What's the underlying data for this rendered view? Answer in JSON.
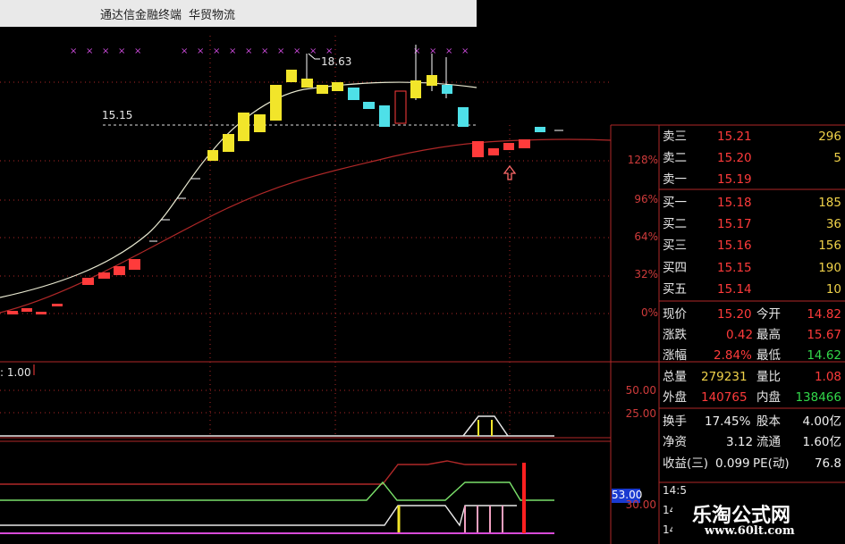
{
  "window": {
    "app_title": "通达信金融终端",
    "stock_name": "华贸物流"
  },
  "chart": {
    "high_marker": "18.63",
    "ref_line_label": "15.15",
    "pct_axis": [
      "128%",
      "96%",
      "64%",
      "32%",
      "0%"
    ],
    "sub1_label": ": 1.00",
    "sub1_axis": [
      "50.00",
      "25.00"
    ],
    "sub2_axis": [
      "53.00",
      "30.00"
    ]
  },
  "quote": {
    "asks": [
      {
        "label": "卖三",
        "price": "15.21",
        "vol": "296"
      },
      {
        "label": "卖二",
        "price": "15.20",
        "vol": "5"
      },
      {
        "label": "卖一",
        "price": "15.19",
        "vol": ""
      }
    ],
    "bids": [
      {
        "label": "买一",
        "price": "15.18",
        "vol": "185"
      },
      {
        "label": "买二",
        "price": "15.17",
        "vol": "36"
      },
      {
        "label": "买三",
        "price": "15.16",
        "vol": "156"
      },
      {
        "label": "买四",
        "price": "15.15",
        "vol": "190"
      },
      {
        "label": "买五",
        "price": "15.14",
        "vol": "10"
      }
    ],
    "stats": {
      "now_label": "现价",
      "now": "15.20",
      "open_label": "今开",
      "open": "14.82",
      "chg_label": "涨跌",
      "chg": "0.42",
      "high_label": "最高",
      "high": "15.67",
      "pct_label": "涨幅",
      "pct": "2.84%",
      "low_label": "最低",
      "low": "14.62",
      "vol_label": "总量",
      "vol": "279231",
      "ratio_label": "量比",
      "ratio": "1.08",
      "out_label": "外盘",
      "out": "140765",
      "in_label": "内盘",
      "in": "138466",
      "turn_label": "换手",
      "turn": "17.45%",
      "cap_label": "股本",
      "cap": "4.00亿",
      "nav_label": "净资",
      "nav": "3.12",
      "float_label": "流通",
      "float": "1.60亿",
      "eps_label": "收益(三)",
      "eps": "0.099",
      "pe_label": "PE(动)",
      "pe": "76.8"
    },
    "ticks_partial": [
      "14:5",
      "14",
      "14"
    ]
  },
  "watermark": {
    "name": "乐淘公式网",
    "url": "www.60lt.com"
  },
  "colors": {
    "up": "#ff3b3b",
    "down": "#4ee0e8",
    "ma_short": "#e8e8d0",
    "ma_long": "#b02828",
    "accent_yellow": "#f2e52a"
  }
}
